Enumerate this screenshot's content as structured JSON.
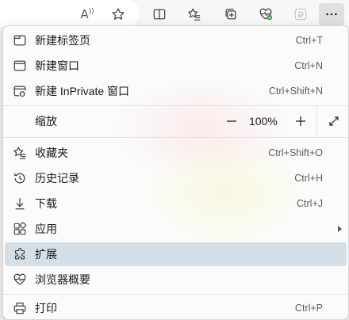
{
  "toolbar": {
    "read_aloud_label": "A",
    "read_aloud_sup": "))",
    "icons": [
      "read-aloud-icon",
      "favorite-star-icon",
      "split-screen-icon",
      "favorites-icon",
      "collections-icon",
      "browser-essentials-icon",
      "ie-mode-icon",
      "more-icon"
    ]
  },
  "menu": {
    "new_tab": {
      "label": "新建标签页",
      "shortcut": "Ctrl+T"
    },
    "new_window": {
      "label": "新建窗口",
      "shortcut": "Ctrl+N"
    },
    "new_inprivate": {
      "label": "新建 InPrivate 窗口",
      "shortcut": "Ctrl+Shift+N"
    },
    "zoom": {
      "label": "缩放",
      "minus": "—",
      "value": "100%",
      "plus": "+"
    },
    "favorites": {
      "label": "收藏夹",
      "shortcut": "Ctrl+Shift+O"
    },
    "history": {
      "label": "历史记录",
      "shortcut": "Ctrl+H"
    },
    "downloads": {
      "label": "下载",
      "shortcut": "Ctrl+J"
    },
    "apps": {
      "label": "应用",
      "shortcut": ""
    },
    "extensions": {
      "label": "扩展",
      "shortcut": ""
    },
    "essentials": {
      "label": "浏览器概要",
      "shortcut": ""
    },
    "print": {
      "label": "打印",
      "shortcut": "Ctrl+P"
    }
  },
  "colors": {
    "hover_bg": "#d5dfe8",
    "menu_bg": "#fbfbfb",
    "essentials_heart_badge": "#2e9e4f"
  }
}
